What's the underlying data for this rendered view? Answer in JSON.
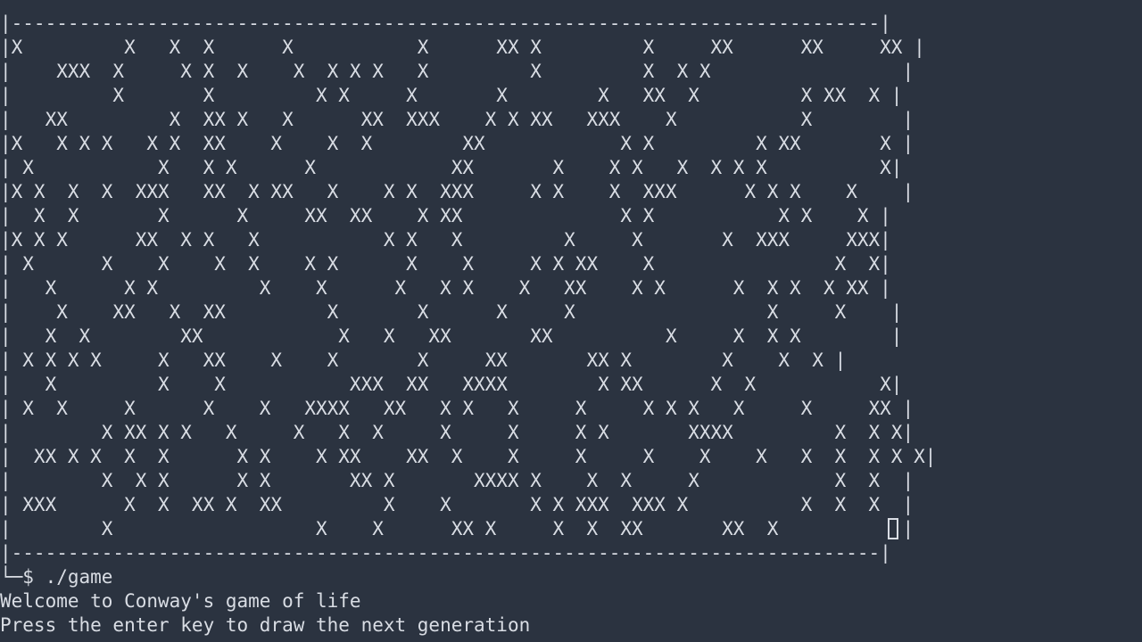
{
  "terminal": {
    "board": {
      "top_border": "|-----------------------------------------------------------------------------|",
      "rows": [
        "|X         X   X  X      X           X      XX X         X     XX      XX     XX |",
        "|    XXX  X     X X  X    X  X X X   X         X         X  X X                 |",
        "|         X       X         X X     X       X        X   XX  X         X XX  X |",
        "|   XX         X  XX X   X      XX  XXX    X X XX   XXX    X           X        |",
        "|X   X X X   X X  XX    X    X  X        XX            X X         X XX       X |",
        "| X           X   X X      X            XX       X    X X   X  X X X          X|",
        "|X X  X  X  XXX   XX  X XX   X    X X  XXX     X X    X  XXX      X X X    X    |",
        "|  X  X       X      X     XX  XX    X XX              X X           X X    X |",
        "|X X X      XX  X X   X           X X   X         X     X       X  XXX     XXX|",
        "| X      X    X    X  X    X X      X    X     X X XX    X                X  X|",
        "|   X      X X         X    X      X   X X    X   XX    X X      X  X X  X XX |",
        "|    X    XX   X  XX         X       X      X     X                 X     X    |",
        "|   X  X        XX            X   X   XX       XX          X     X  X X        |",
        "| X X X X     X   XX    X    X       X     XX       XX X        X    X  X |",
        "|   X         X    X           XXX  XX   XXXX        X XX      X  X           X|",
        "| X  X     X      X    X   XXXX   XX   X X   X     X     X X X   X     X     XX |",
        "|        X XX X X   X     X   X  X     X     X     X X       XXXX         X  X X|",
        "|  XX X X  X  X      X X    X XX    XX  X    X     X     X    X    X   X  X  X X X|",
        "|        X  X X      X X       XX X       XXXX X    X  X     X            X  X  |",
        "| XXX      X  X  XX X  XX         X    X       X X XXX  XXX X          X  X  X  |",
        "|        X                  X    X      XX X     X  X  XX       XX  X           |"
      ],
      "bottom_border": "|-----------------------------------------------------------------------------|"
    },
    "prompt_line": "└─$ ./game",
    "output_lines": [
      "Welcome to Conway's game of life",
      "Press the enter key to draw the next generation"
    ]
  }
}
